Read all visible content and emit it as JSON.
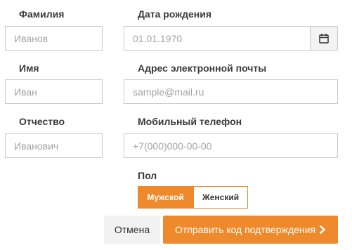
{
  "form": {
    "last_name": {
      "label": "Фамилия",
      "placeholder": "Иванов"
    },
    "first_name": {
      "label": "Имя",
      "placeholder": "Иван"
    },
    "patronymic": {
      "label": "Отчество",
      "placeholder": "Иванович"
    },
    "birth_date": {
      "label": "Дата рождения",
      "placeholder": "01.01.1970",
      "calendar_icon": "calendar-icon"
    },
    "email": {
      "label": "Адрес электронной почты",
      "placeholder": "sample@mail.ru"
    },
    "phone": {
      "label": "Мобильный телефон",
      "placeholder": "+7(000)000-00-00"
    },
    "gender": {
      "label": "Пол",
      "options": [
        "Мужской",
        "Женский"
      ],
      "selected": "Мужской"
    }
  },
  "actions": {
    "cancel_label": "Отмена",
    "submit_label": "Отправить код подтверждения",
    "submit_icon": "chevron-right-icon"
  },
  "colors": {
    "accent": "#ee8a2b",
    "input_border": "#c9c9c9",
    "cancel_bg": "#f2f2f2"
  }
}
